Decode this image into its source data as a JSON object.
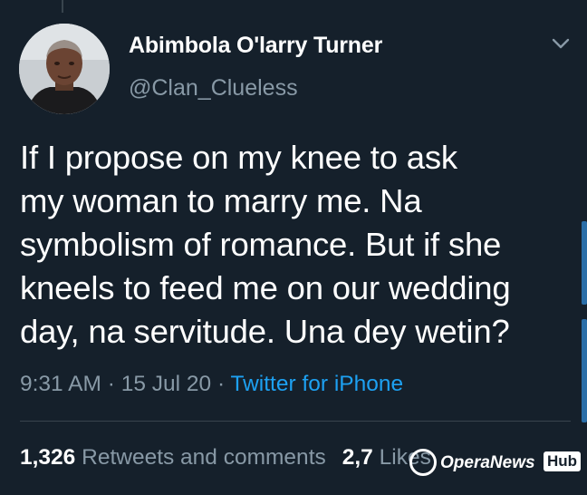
{
  "tweet": {
    "author": {
      "display_name": "Abimbola O'larry Turner",
      "handle": "@Clan_Clueless",
      "avatar_icon": "profile-photo"
    },
    "menu_icon": "chevron-down-icon",
    "text_lines": [
      "If I propose on my knee to ask",
      "my woman to marry me. Na",
      "symbolism of romance. But if she",
      "kneels to feed me on our wedding",
      "day, na servitude. Una dey wetin?"
    ],
    "time": "9:31 AM",
    "separator": "·",
    "date": "15 Jul 20",
    "source": "Twitter for iPhone",
    "stats": {
      "retweets_count": "1,326",
      "retweets_label": "Retweets and comments",
      "likes_count": "2,7",
      "likes_label": "Likes"
    }
  },
  "watermark": {
    "text": "OperaNews",
    "badge": "Hub"
  },
  "colors": {
    "background": "#15202b",
    "primary_text": "#ffffff",
    "secondary_text": "#8899a6",
    "link": "#1da1f2",
    "divider": "#38444d"
  }
}
